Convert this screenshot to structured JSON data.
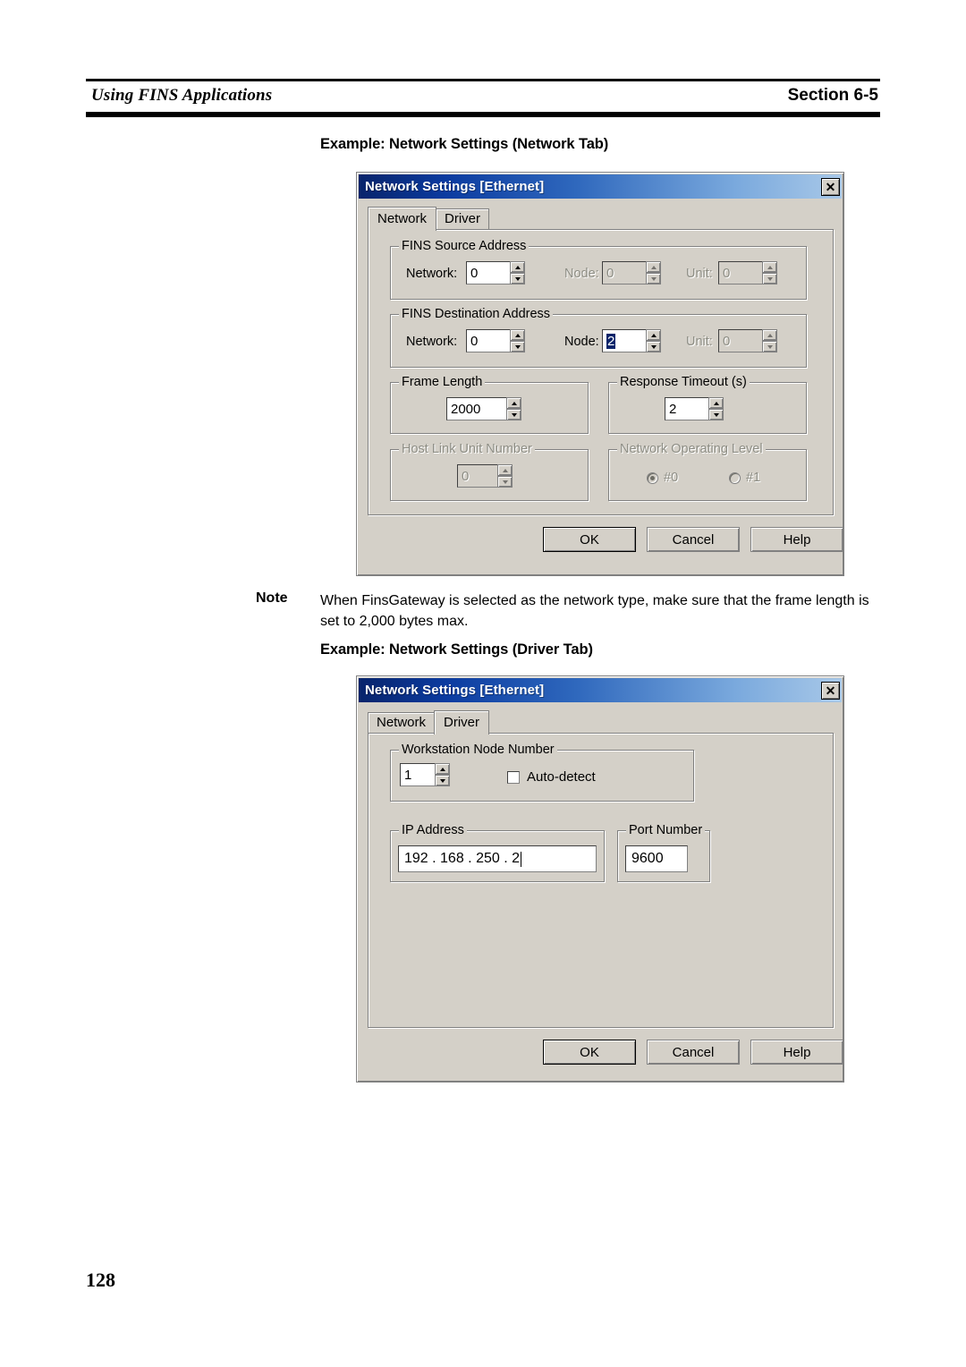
{
  "page": {
    "header_left": "Using FINS Applications",
    "header_right": "Section 6-5",
    "page_number": "128",
    "caption_network": "Example: Network Settings (Network Tab)",
    "caption_driver": "Example: Network Settings (Driver Tab)",
    "note_label": "Note",
    "note_text": "When FinsGateway is selected as the network type, make sure that the frame length is set to 2,000 bytes max."
  },
  "dialog_network": {
    "title": "Network Settings [Ethernet]",
    "close_label": "✕",
    "tabs": [
      {
        "label": "Network",
        "active": true
      },
      {
        "label": "Driver",
        "active": false
      }
    ],
    "fins_source": {
      "legend": "FINS Source Address",
      "network_label": "Network:",
      "network_value": "0",
      "node_label": "Node:",
      "node_value": "0",
      "unit_label": "Unit:",
      "unit_value": "0"
    },
    "fins_destination": {
      "legend": "FINS Destination Address",
      "network_label": "Network:",
      "network_value": "0",
      "node_label": "Node:",
      "node_value": "2",
      "unit_label": "Unit:",
      "unit_value": "0"
    },
    "frame_length": {
      "legend": "Frame Length",
      "value": "2000"
    },
    "response_timeout": {
      "legend": "Response Timeout (s)",
      "value": "2"
    },
    "host_link_unit": {
      "legend": "Host Link Unit Number",
      "value": "0"
    },
    "network_operating_level": {
      "legend": "Network Operating Level",
      "option0": "#0",
      "option1": "#1"
    },
    "buttons": {
      "ok": "OK",
      "cancel": "Cancel",
      "help": "Help"
    }
  },
  "dialog_driver": {
    "title": "Network Settings [Ethernet]",
    "close_label": "✕",
    "tabs": [
      {
        "label": "Network",
        "active": false
      },
      {
        "label": "Driver",
        "active": true
      }
    ],
    "workstation_node": {
      "legend": "Workstation Node Number",
      "value": "1",
      "autodetect_label": "Auto-detect",
      "autodetect_checked": false
    },
    "ip_address": {
      "legend": "IP Address",
      "value": "192 .  168 .  250 .   2"
    },
    "port_number": {
      "legend": "Port Number",
      "value": "9600"
    },
    "buttons": {
      "ok": "OK",
      "cancel": "Cancel",
      "help": "Help"
    }
  },
  "colors": {
    "dialog_face": "#d4d0c8",
    "title_gradient_start": "#08246b",
    "title_gradient_end": "#a8c8e8",
    "selection_blue": "#0a246a",
    "disabled_text": "#8d8d84"
  }
}
